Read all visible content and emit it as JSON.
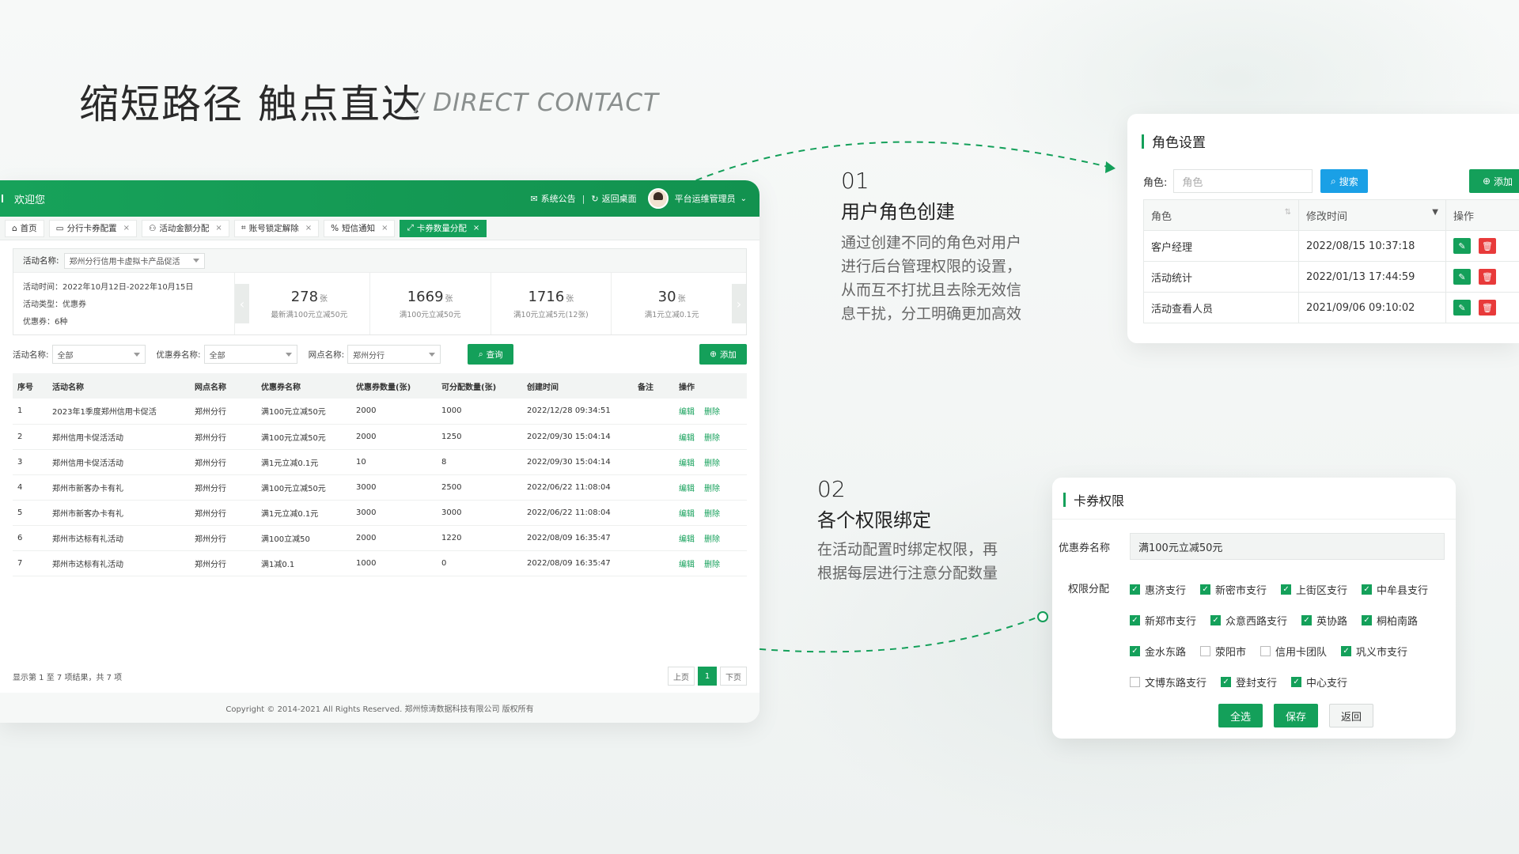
{
  "hero": {
    "title": "缩短路径 触点直达",
    "subtitle": "/ DIRECT CONTACT"
  },
  "admin": {
    "welcome": "欢迎您",
    "top_links": {
      "notice": "系统公告",
      "home": "返回桌面",
      "user": "平台运维管理员"
    },
    "tabs": [
      "首页",
      "分行卡券配置",
      "活动金额分配",
      "账号锁定解除",
      "短信通知",
      "卡券数量分配"
    ],
    "activity": {
      "name_label": "活动名称:",
      "name_value": "郑州分行信用卡虚拟卡产品促活",
      "time_line": "活动时间：2022年10月12日-2022年10月15日",
      "type_line": "活动类型：优惠券",
      "coupon_line": "优惠券：6种"
    },
    "stats": [
      {
        "num": "278",
        "unit": "张",
        "cap": "最新满100元立减50元"
      },
      {
        "num": "1669",
        "unit": "张",
        "cap": "满100元立减50元"
      },
      {
        "num": "1716",
        "unit": "张",
        "cap": "满10元立减5元(12张)"
      },
      {
        "num": "30",
        "unit": "张",
        "cap": "满1元立减0.1元"
      }
    ],
    "filters": {
      "activity_label": "活动名称:",
      "activity_value": "全部",
      "coupon_label": "优惠券名称:",
      "coupon_value": "全部",
      "branch_label": "网点名称:",
      "branch_value": "郑州分行",
      "query": "查询",
      "add": "添加"
    },
    "table": {
      "headers": [
        "序号",
        "活动名称",
        "网点名称",
        "优惠券名称",
        "优惠券数量(张)",
        "可分配数量(张)",
        "创建时间",
        "备注",
        "操作"
      ],
      "edit": "编辑",
      "delete": "删除",
      "rows": [
        [
          "1",
          "2023年1季度郑州信用卡促活",
          "郑州分行",
          "满100元立减50元",
          "2000",
          "1000",
          "2022/12/28 09:34:51",
          ""
        ],
        [
          "2",
          "郑州信用卡促活活动",
          "郑州分行",
          "满100元立减50元",
          "2000",
          "1250",
          "2022/09/30 15:04:14",
          ""
        ],
        [
          "3",
          "郑州信用卡促活活动",
          "郑州分行",
          "满1元立减0.1元",
          "10",
          "8",
          "2022/09/30 15:04:14",
          ""
        ],
        [
          "4",
          "郑州市新客办卡有礼",
          "郑州分行",
          "满100元立减50元",
          "3000",
          "2500",
          "2022/06/22 11:08:04",
          ""
        ],
        [
          "5",
          "郑州市新客办卡有礼",
          "郑州分行",
          "满1元立减0.1元",
          "3000",
          "3000",
          "2022/06/22 11:08:04",
          ""
        ],
        [
          "6",
          "郑州市达标有礼活动",
          "郑州分行",
          "满100立减50",
          "2000",
          "1220",
          "2022/08/09 16:35:47",
          ""
        ],
        [
          "7",
          "郑州市达标有礼活动",
          "郑州分行",
          "满1减0.1",
          "1000",
          "0",
          "2022/08/09 16:35:47",
          ""
        ]
      ]
    },
    "pager": {
      "summary": "显示第 1 至 7 项结果，共 7 项",
      "prev": "上页",
      "current": "1",
      "next": "下页"
    },
    "copyright": "Copyright © 2014-2021 All Rights Reserved. 郑州惊涛数据科技有限公司 版权所有"
  },
  "feature1": {
    "num": "01",
    "title": "用户角色创建",
    "desc": [
      "通过创建不同的角色对用户",
      "进行后台管理权限的设置，",
      "从而互不打扰且去除无效信",
      "息干扰，分工明确更加高效"
    ]
  },
  "feature2": {
    "num": "02",
    "title": "各个权限绑定",
    "desc": [
      "在活动配置时绑定权限，再",
      "根据每层进行注意分配数量"
    ]
  },
  "role_panel": {
    "title": "角色设置",
    "search_label": "角色:",
    "search_placeholder": "角色",
    "search_btn": "搜索",
    "add_btn": "添加",
    "headers": [
      "角色",
      "修改时间",
      "操作"
    ],
    "rows": [
      [
        "客户经理",
        "2022/08/15 10:37:18"
      ],
      [
        "活动统计",
        "2022/01/13 17:44:59"
      ],
      [
        "活动查看人员",
        "2021/09/06 09:10:02"
      ]
    ]
  },
  "card_panel": {
    "title": "卡券权限",
    "coupon_label": "优惠券名称",
    "coupon_value": "满100元立减50元",
    "perm_label": "权限分配",
    "checkboxes": [
      [
        {
          "label": "惠济支行",
          "checked": true
        },
        {
          "label": "新密市支行",
          "checked": true
        },
        {
          "label": "上街区支行",
          "checked": true
        },
        {
          "label": "中牟县支行",
          "checked": true
        }
      ],
      [
        {
          "label": "新郑市支行",
          "checked": true
        },
        {
          "label": "众意西路支行",
          "checked": true
        },
        {
          "label": "英协路",
          "checked": true
        },
        {
          "label": "桐柏南路",
          "checked": true
        }
      ],
      [
        {
          "label": "金水东路",
          "checked": true
        },
        {
          "label": "荥阳市",
          "checked": false
        },
        {
          "label": "信用卡团队",
          "checked": false
        },
        {
          "label": "巩义市支行",
          "checked": true
        }
      ],
      [
        {
          "label": "文博东路支行",
          "checked": false
        },
        {
          "label": "登封支行",
          "checked": true
        },
        {
          "label": "中心支行",
          "checked": true
        }
      ]
    ],
    "select_all": "全选",
    "save": "保存",
    "back": "返回"
  },
  "colors": {
    "accent": "#14a05a",
    "search": "#1aa0e6",
    "danger": "#e83a3a"
  }
}
